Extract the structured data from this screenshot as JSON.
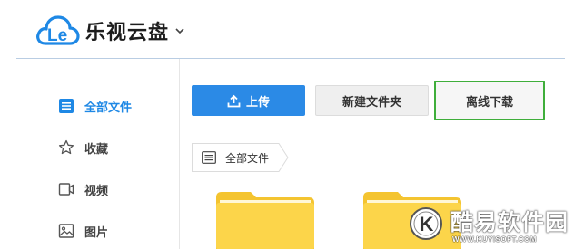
{
  "app": {
    "brand_mark": "Le",
    "title": "乐视云盘"
  },
  "sidebar": {
    "items": [
      {
        "label": "全部文件",
        "icon": "list-icon",
        "active": true
      },
      {
        "label": "收藏",
        "icon": "star-icon",
        "active": false
      },
      {
        "label": "视频",
        "icon": "video-icon",
        "active": false
      },
      {
        "label": "图片",
        "icon": "image-icon",
        "active": false
      }
    ]
  },
  "toolbar": {
    "upload_label": "上传",
    "new_folder_label": "新建文件夹",
    "offline_download_label": "离线下载"
  },
  "breadcrumb": {
    "current": "全部文件"
  },
  "folders": [
    {
      "icon": "folder-icon"
    },
    {
      "icon": "folder-icon"
    }
  ],
  "watermark": {
    "badge_letter": "K",
    "title": "酷易软件园",
    "url": "WWW.KUYISOFT.COM"
  },
  "colors": {
    "accent_blue": "#2b8ae6",
    "active_text": "#1e88e5",
    "highlight_green": "#3fae3b",
    "folder_yellow": "#fcd54a",
    "divider": "#b9cde3"
  }
}
